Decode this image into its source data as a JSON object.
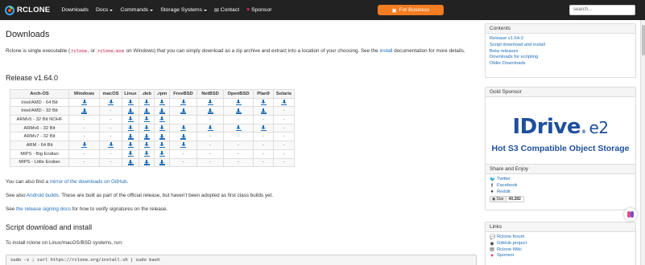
{
  "navbar": {
    "brand": "RCLONE",
    "links": [
      {
        "label": "Downloads",
        "caret": false
      },
      {
        "label": "Docs",
        "caret": true
      },
      {
        "label": "Commands",
        "caret": true
      },
      {
        "label": "Storage Systems",
        "caret": true
      },
      {
        "label": "Contact",
        "caret": false
      },
      {
        "label": "Sponsor",
        "caret": false
      }
    ],
    "business_label": "For Business",
    "business_color": "#f47c21",
    "search_placeholder": "search..."
  },
  "main": {
    "title": "Downloads",
    "intro": {
      "p1": "Rclone is single executable (",
      "code1": "rclone",
      "p2": ", or ",
      "code2": "rclone.exe",
      "p3": " on Windows) that you can simply download as a zip archive and extract into a location of your choosing. See the ",
      "link": "install",
      "p4": " documentation for more details."
    },
    "release_title": "Release v1.64.0",
    "table": {
      "headers": [
        "Arch-OS",
        "Windows",
        "macOS",
        "Linux",
        ".deb",
        ".rpm",
        "FreeBSD",
        "NetBSD",
        "OpenBSD",
        "Plan9",
        "Solaris"
      ],
      "rows": [
        {
          "arch": "Intel/AMD - 64 Bit",
          "cells": [
            "dl",
            "dl",
            "dl",
            "dl",
            "dl",
            "dl",
            "dl",
            "dl",
            "dl",
            "dl"
          ]
        },
        {
          "arch": "Intel/AMD - 32 Bit",
          "cells": [
            "dl",
            "-",
            "dl",
            "dl",
            "dl",
            "dl",
            "dl",
            "dl",
            "dl",
            "-"
          ]
        },
        {
          "arch": "ARMv5 - 32 Bit NOHF",
          "cells": [
            "-",
            "-",
            "dl",
            "dl",
            "dl",
            "-",
            "-",
            "-",
            "-",
            "-"
          ]
        },
        {
          "arch": "ARMv6 - 32 Bit",
          "cells": [
            "-",
            "-",
            "dl",
            "dl",
            "dl",
            "dl",
            "dl",
            "dl",
            "dl",
            "-"
          ]
        },
        {
          "arch": "ARMv7 - 32 Bit",
          "cells": [
            "-",
            "-",
            "dl",
            "dl",
            "dl",
            "dl",
            "-",
            "-",
            "-",
            "-"
          ]
        },
        {
          "arch": "ARM - 64 Bit",
          "cells": [
            "dl",
            "dl",
            "dl",
            "dl",
            "dl",
            "dl",
            "-",
            "-",
            "-",
            "-"
          ]
        },
        {
          "arch": "MIPS - Big Endian",
          "cells": [
            "-",
            "-",
            "dl",
            "dl",
            "dl",
            "-",
            "-",
            "-",
            "-",
            "-"
          ]
        },
        {
          "arch": "MIPS - Little Endian",
          "cells": [
            "-",
            "-",
            "dl",
            "dl",
            "dl",
            "-",
            "-",
            "-",
            "-",
            "-"
          ]
        }
      ]
    },
    "mirror": {
      "p1": "You can also find a ",
      "link": "mirror of the downloads on GitHub",
      "p2": "."
    },
    "android": {
      "p1": "See also ",
      "link": "Android builds",
      "p2": ". These are built as part of the official release, but haven't been adopted as first class builds yet."
    },
    "signing": {
      "p1": "See ",
      "link": "the release signing docs",
      "p2": " for how to verify signatures on the release."
    },
    "script_title": "Script download and install",
    "script_intro": "To install rclone on Linux/macOS/BSD systems, run:",
    "script_cmd": "sudo -v ; curl https://rclone.org/install.sh | sudo bash"
  },
  "sidebar": {
    "contents": {
      "title": "Contents",
      "items": [
        "Release v1.64.0",
        "Script download and install",
        "Beta releases",
        "Downloads for scripting",
        "Older Downloads"
      ]
    },
    "gold": {
      "title": "Gold Sponsor",
      "logo_text": "IDrive",
      "logo_reg": "®",
      "logo_suffix": "e2",
      "tagline": "Hot S3 Compatible Object Storage",
      "brand_color": "#1e4f9c"
    },
    "share": {
      "title": "Share and Enjoy",
      "items": [
        {
          "icon": "twitter-icon",
          "label": "Twitter"
        },
        {
          "icon": "facebook-icon",
          "label": "Facebook"
        },
        {
          "icon": "reddit-icon",
          "label": "Reddit"
        }
      ],
      "star_label": "Star",
      "star_count": "40,282"
    },
    "links": {
      "title": "Links",
      "items": [
        {
          "icon": "forum-icon",
          "label": "Rclone forum"
        },
        {
          "icon": "github-icon",
          "label": "GitHub project"
        },
        {
          "icon": "wiki-icon",
          "label": "Rclone Wiki"
        },
        {
          "icon": "heart-icon",
          "label": "Sponsor"
        }
      ]
    }
  }
}
